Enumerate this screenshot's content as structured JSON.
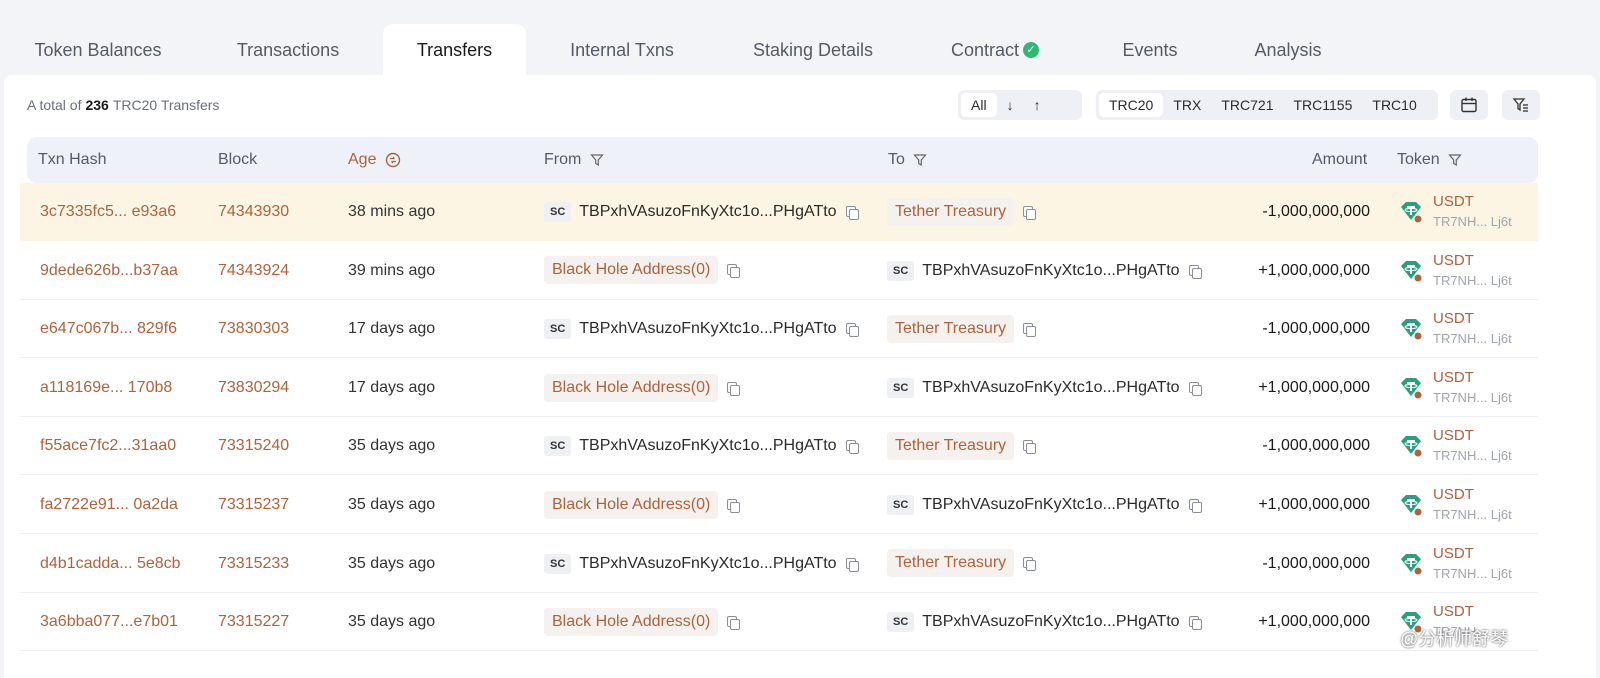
{
  "tabs": [
    {
      "label": "Token Balances"
    },
    {
      "label": "Transactions"
    },
    {
      "label": "Transfers"
    },
    {
      "label": "Internal Txns"
    },
    {
      "label": "Staking Details"
    },
    {
      "label": "Contract"
    },
    {
      "label": "Events"
    },
    {
      "label": "Analysis"
    }
  ],
  "summary": {
    "prefix": "A total of",
    "count": "236",
    "suffix": "TRC20 Transfers"
  },
  "direction_filter": {
    "all": "All",
    "in": "↓",
    "out": "↑"
  },
  "token_types": [
    "TRC20",
    "TRX",
    "TRC721",
    "TRC1155",
    "TRC10"
  ],
  "columns": {
    "hash": "Txn Hash",
    "block": "Block",
    "age": "Age",
    "from": "From",
    "to": "To",
    "amount": "Amount",
    "token": "Token"
  },
  "sc_label": "SC",
  "rows": [
    {
      "hash": "3c7335fc5... e93a6",
      "block": "74343930",
      "age": "38 mins ago",
      "from": "TBPxhVAsuzoFnKyXtc1o...PHgATto",
      "to": "Tether Treasury",
      "amount": "-1,000,000,000",
      "token": "USDT",
      "token_addr": "TR7NH...  Lj6t"
    },
    {
      "hash": "9dede626b...b37aa",
      "block": "74343924",
      "age": "39 mins ago",
      "from": "Black Hole Address(0)",
      "to": "TBPxhVAsuzoFnKyXtc1o...PHgATto",
      "amount": "+1,000,000,000",
      "token": "USDT",
      "token_addr": "TR7NH...  Lj6t"
    },
    {
      "hash": "e647c067b... 829f6",
      "block": "73830303",
      "age": "17 days ago",
      "from": "TBPxhVAsuzoFnKyXtc1o...PHgATto",
      "to": "Tether Treasury",
      "amount": "-1,000,000,000",
      "token": "USDT",
      "token_addr": "TR7NH...  Lj6t"
    },
    {
      "hash": "a118169e...  170b8",
      "block": "73830294",
      "age": "17 days ago",
      "from": "Black Hole Address(0)",
      "to": "TBPxhVAsuzoFnKyXtc1o...PHgATto",
      "amount": "+1,000,000,000",
      "token": "USDT",
      "token_addr": "TR7NH...  Lj6t"
    },
    {
      "hash": "f55ace7fc2...31aa0",
      "block": "73315240",
      "age": "35 days ago",
      "from": "TBPxhVAsuzoFnKyXtc1o...PHgATto",
      "to": "Tether Treasury",
      "amount": "-1,000,000,000",
      "token": "USDT",
      "token_addr": "TR7NH...  Lj6t"
    },
    {
      "hash": "fa2722e91... 0a2da",
      "block": "73315237",
      "age": "35 days ago",
      "from": "Black Hole Address(0)",
      "to": "TBPxhVAsuzoFnKyXtc1o...PHgATto",
      "amount": "+1,000,000,000",
      "token": "USDT",
      "token_addr": "TR7NH...  Lj6t"
    },
    {
      "hash": "d4b1cadda... 5e8cb",
      "block": "73315233",
      "age": "35 days ago",
      "from": "TBPxhVAsuzoFnKyXtc1o...PHgATto",
      "to": "Tether Treasury",
      "amount": "-1,000,000,000",
      "token": "USDT",
      "token_addr": "TR7NH...  Lj6t"
    },
    {
      "hash": "3a6bba077...e7b01",
      "block": "73315227",
      "age": "35 days ago",
      "from": "Black Hole Address(0)",
      "to": "TBPxhVAsuzoFnKyXtc1o...PHgATto",
      "amount": "+1,000,000,000",
      "token": "USDT",
      "token_addr": "TR7NH..."
    }
  ],
  "watermark": "@分析师舒琴",
  "colors": {
    "accent": "#b0623a",
    "highlight_row": "#fdf5e4",
    "tether": "#26a17b",
    "verified": "#2eb872"
  }
}
